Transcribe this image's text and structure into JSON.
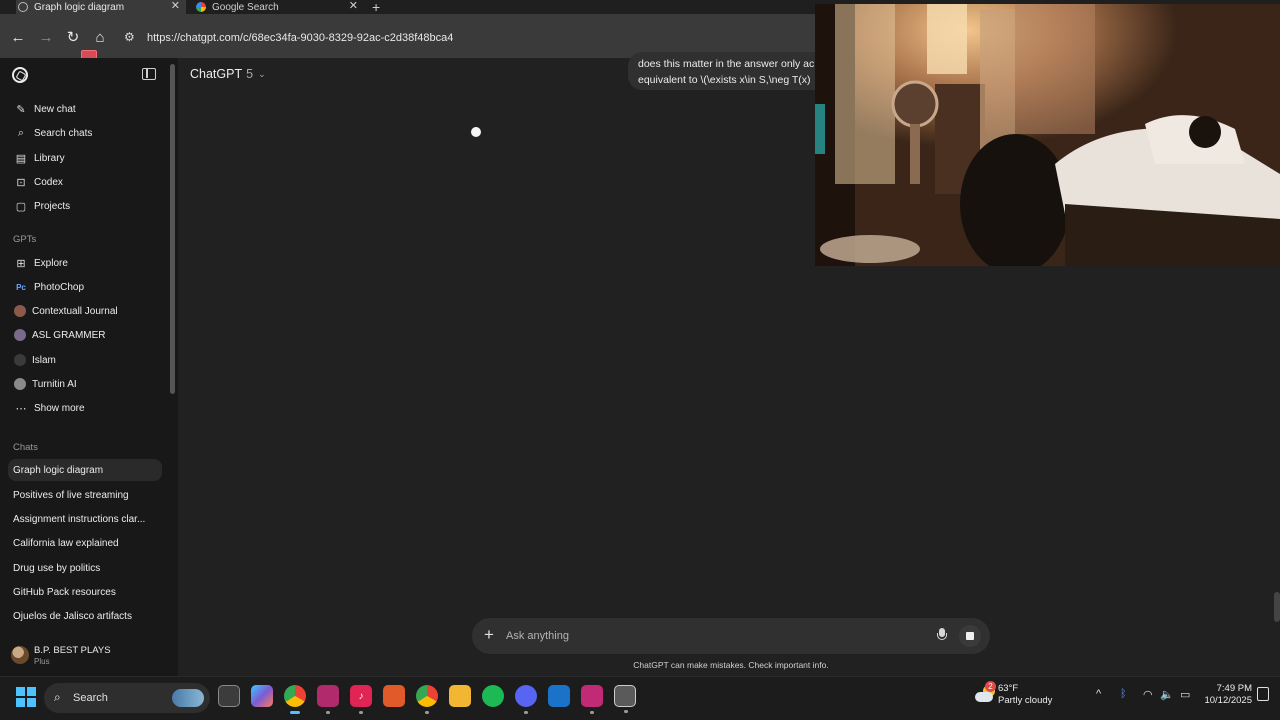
{
  "browser": {
    "tabs": [
      {
        "title": "Graph logic diagram",
        "active": true
      },
      {
        "title": "Google Search",
        "active": false
      }
    ],
    "new_tab_symbol": "+",
    "close_symbol": "✕",
    "url": "https://chatgpt.com/c/68ec34fa-9030-8329-92ac-c2d38f48bca4",
    "nav_icons": {
      "back": "←",
      "forward": "→",
      "reload": "↻",
      "home": "⌂",
      "site_info": "⚙"
    }
  },
  "sidebar": {
    "primary": [
      {
        "label": "New chat",
        "icon": "✎"
      },
      {
        "label": "Search chats",
        "icon": "⌕"
      },
      {
        "label": "Library",
        "icon": "▤"
      },
      {
        "label": "Codex",
        "icon": "⊡"
      },
      {
        "label": "Projects",
        "icon": "▢"
      }
    ],
    "gpts_heading": "GPTs",
    "gpts": [
      {
        "label": "Explore",
        "icon": "⊞"
      },
      {
        "label": "PhotoChop",
        "icon": "Pc"
      },
      {
        "label": "Contextuall Journal",
        "icon_color": "#8c5a4a"
      },
      {
        "label": "ASL GRAMMER",
        "icon_color": "#7a6a8c"
      },
      {
        "label": "Islam",
        "icon_color": "#3a3a3a"
      },
      {
        "label": "Turnitin AI",
        "icon_color": "#8a8a8a"
      }
    ],
    "show_more": {
      "label": "Show more",
      "icon": "⋯"
    },
    "chats_heading": "Chats",
    "chats": [
      {
        "label": "Graph logic diagram",
        "active": true
      },
      {
        "label": "Positives of live streaming",
        "active": false
      },
      {
        "label": "Assignment instructions clar...",
        "active": false
      },
      {
        "label": "California law explained",
        "active": false
      },
      {
        "label": "Drug use by politics",
        "active": false
      },
      {
        "label": "GitHub Pack resources",
        "active": false
      },
      {
        "label": "Ojuelos de Jalisco artifacts",
        "active": false
      }
    ],
    "profile": {
      "name": "B.P. BEST PLAYS",
      "plan": "Plus"
    }
  },
  "main": {
    "model_name": "ChatGPT",
    "model_version": "5",
    "model_chevron": "⌄",
    "user_message": {
      "line1": "does this matter in the answer only ac",
      "line2": "equivalent to \\(\\exists x\\in S,\\neg T(x)"
    },
    "composer": {
      "placeholder": "Ask anything",
      "plus_symbol": "+"
    },
    "disclaimer": "ChatGPT can make mistakes. Check important info."
  },
  "taskbar": {
    "search_label": "Search",
    "search_icon": "⌕",
    "apps": [
      {
        "name": "task-view",
        "label": "",
        "color": "#3c3c3c"
      },
      {
        "name": "copilot",
        "label": "",
        "color": "#7b5cd6"
      },
      {
        "name": "chrome",
        "label": "",
        "color": "#2f8f4e",
        "state": "active"
      },
      {
        "name": "app-pink",
        "label": "",
        "color": "#b12a6c",
        "state": "running"
      },
      {
        "name": "tiktok",
        "label": "♪",
        "color": "#e02454",
        "state": "running"
      },
      {
        "name": "rss-reader",
        "label": "",
        "color": "#e05a2a"
      },
      {
        "name": "chrome-alt",
        "label": "",
        "color": "#2f7fd6",
        "state": "running"
      },
      {
        "name": "file-explorer",
        "label": "",
        "color": "#f2b632"
      },
      {
        "name": "spotify",
        "label": "",
        "color": "#1db954"
      },
      {
        "name": "discord",
        "label": "",
        "color": "#5865f2",
        "state": "running"
      },
      {
        "name": "outlook",
        "label": "",
        "color": "#1a73c8"
      },
      {
        "name": "app-pink-2",
        "label": "",
        "color": "#c02a76",
        "state": "running"
      },
      {
        "name": "app-terminal",
        "label": "",
        "color": "#5a5a5a",
        "state": "running"
      }
    ],
    "weather": {
      "temp": "63°F",
      "desc": "Partly cloudy",
      "badge": "2"
    },
    "tray_icons": {
      "chevron": "^",
      "bluetooth": "ᛒ",
      "wifi": "◠",
      "volume": "🔈",
      "battery": "▭"
    },
    "clock": {
      "time": "7:49 PM",
      "date": "10/12/2025"
    }
  }
}
